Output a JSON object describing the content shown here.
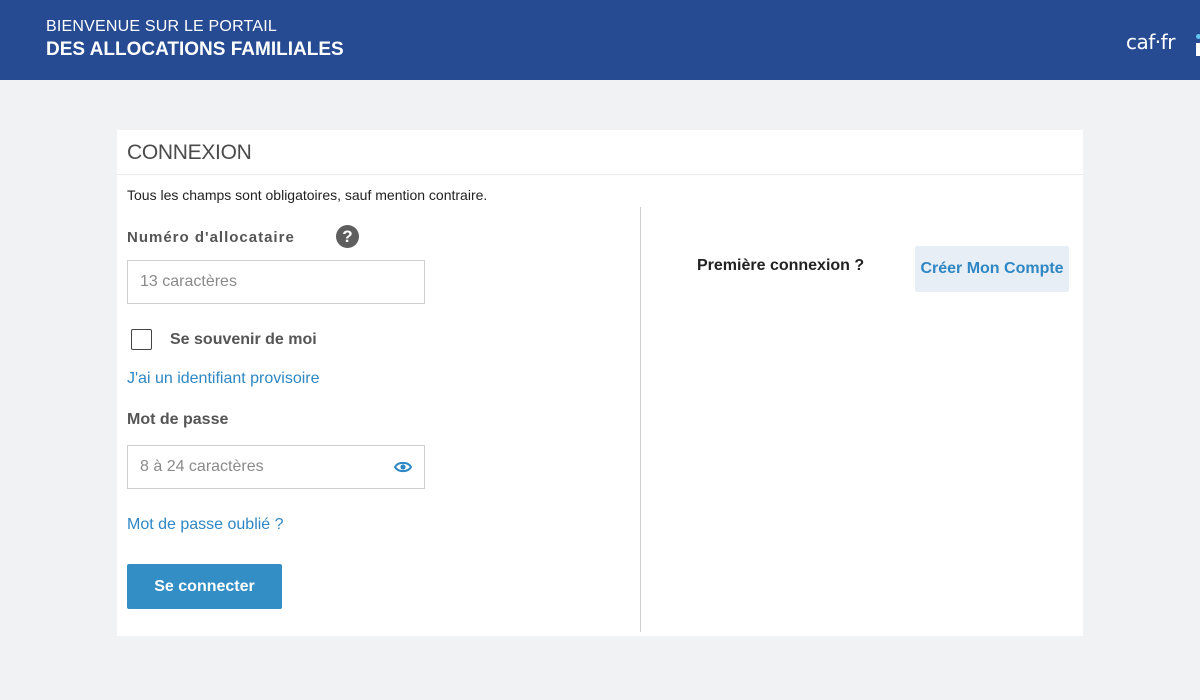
{
  "header": {
    "line1": "BIENVENUE SUR LE PORTAIL",
    "line2": "DES ALLOCATIONS FAMILIALES",
    "logo_text": "caf·fr"
  },
  "login": {
    "title": "CONNEXION",
    "mandatory_note": "Tous les champs sont obligatoires, sauf mention contraire.",
    "number_label": "Numéro d'allocataire",
    "number_placeholder": "13 caractères",
    "number_value": "",
    "remember_label": "Se souvenir de moi",
    "remember_checked": false,
    "provisional_link": "J'ai un identifiant provisoire",
    "password_label": "Mot de passe",
    "password_placeholder": "8 à 24 caractères",
    "password_value": "",
    "forgot_link": "Mot de passe oublié ?",
    "connect_button": "Se connecter"
  },
  "register": {
    "question": "Première connexion ?",
    "create_button": "Créer Mon Compte"
  },
  "icons": {
    "help": "help-icon",
    "eye": "eye-icon"
  },
  "colors": {
    "header_bg": "#264b93",
    "primary": "#338ec5",
    "link": "#2e87c4",
    "secondary_btn_bg": "#e8eef5"
  }
}
